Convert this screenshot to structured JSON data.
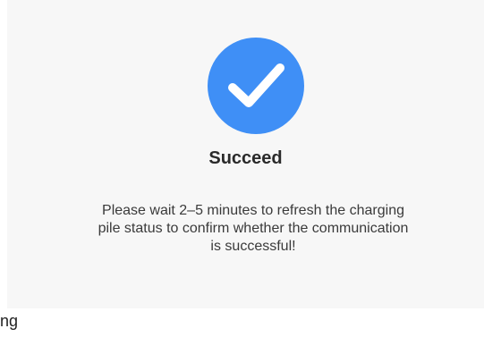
{
  "dialog": {
    "title": "Succeed",
    "message": "Please wait 2–5 minutes to refresh the charging pile status to confirm whether the communication is successful!",
    "status_icon": "check-icon",
    "accent_color": "#3f8ff6"
  },
  "footer": {
    "fragment": "ng"
  }
}
